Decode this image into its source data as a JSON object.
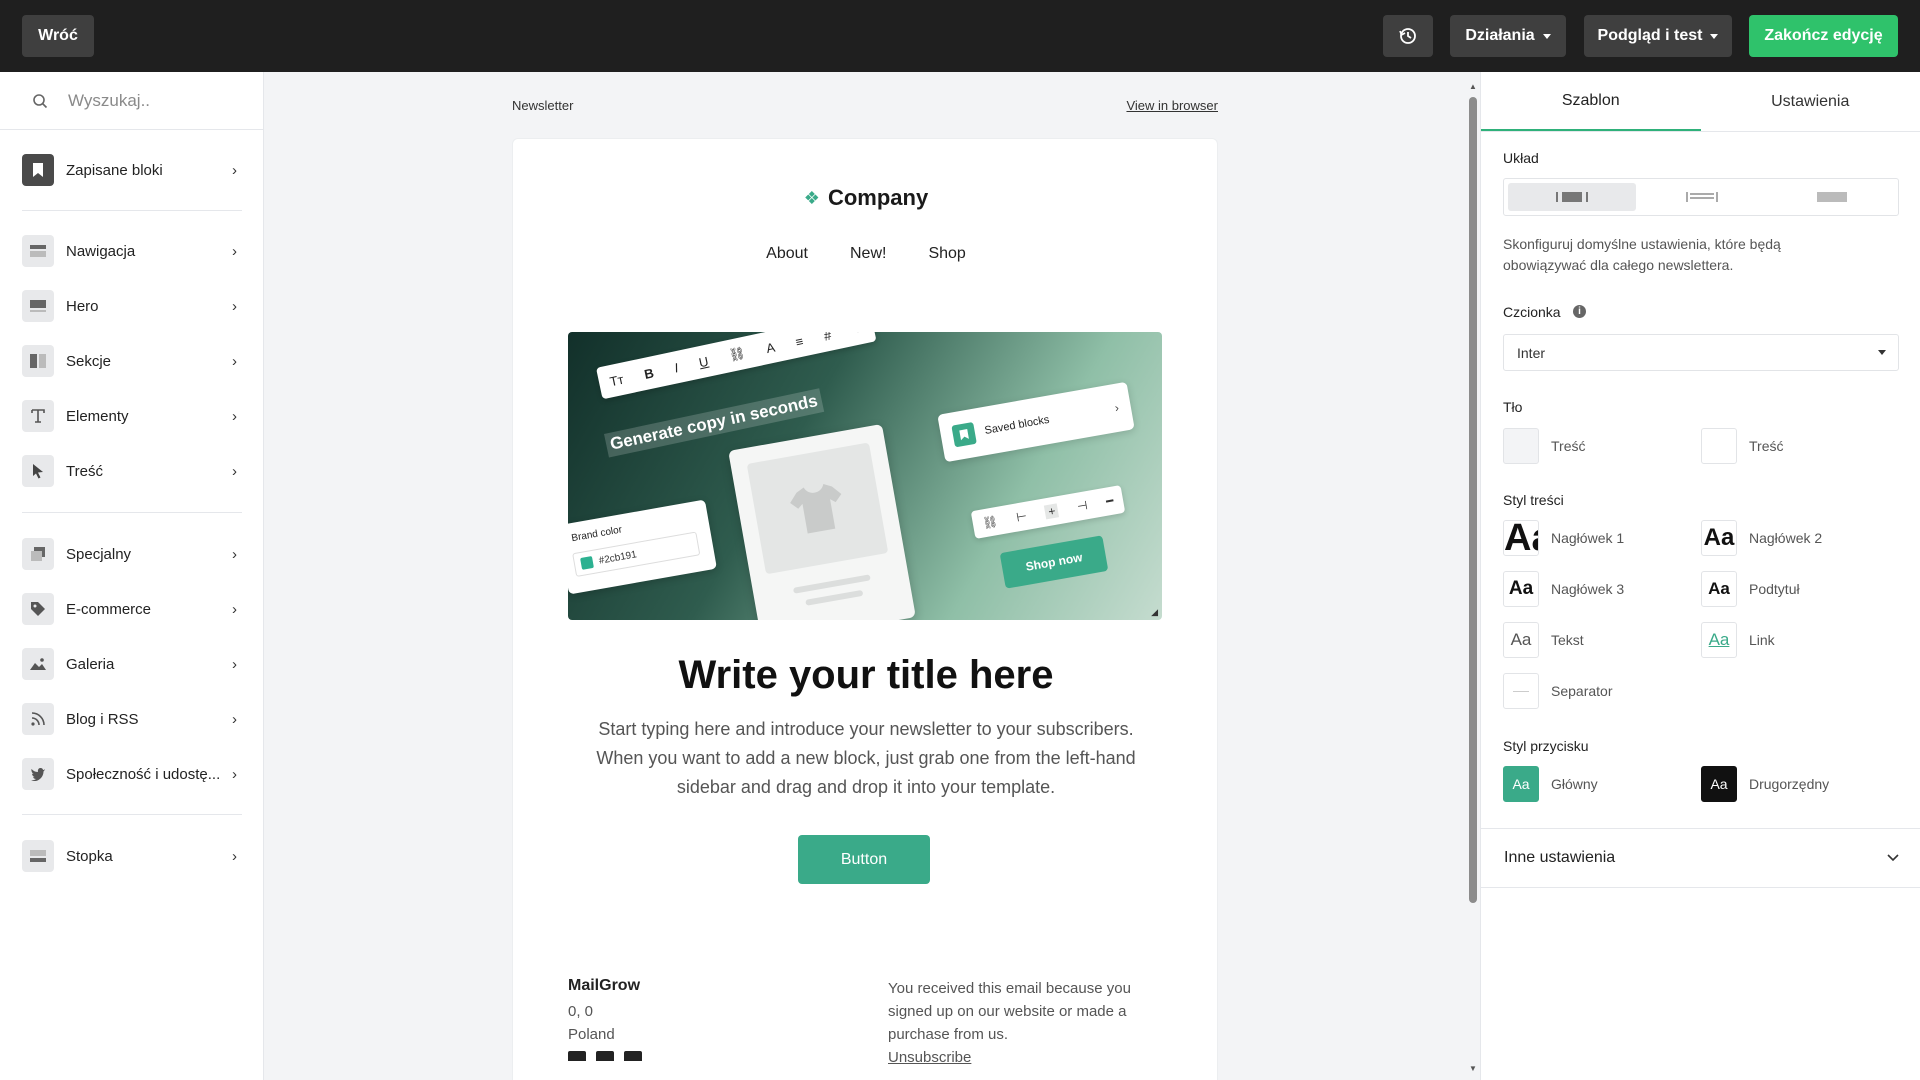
{
  "topbar": {
    "back": "Wróć",
    "actions": "Działania",
    "preview": "Podgląd i test",
    "finish": "Zakończ edycję"
  },
  "sidebar": {
    "search_placeholder": "Wyszukaj..",
    "items": [
      {
        "label": "Zapisane bloki",
        "icon": "bookmark-icon"
      },
      {
        "label": "Nawigacja",
        "icon": "navigation-icon"
      },
      {
        "label": "Hero",
        "icon": "hero-icon"
      },
      {
        "label": "Sekcje",
        "icon": "sections-icon"
      },
      {
        "label": "Elementy",
        "icon": "text-icon"
      },
      {
        "label": "Treść",
        "icon": "cursor-icon"
      },
      {
        "label": "Specjalny",
        "icon": "special-icon"
      },
      {
        "label": "E-commerce",
        "icon": "tag-icon"
      },
      {
        "label": "Galeria",
        "icon": "image-icon"
      },
      {
        "label": "Blog i RSS",
        "icon": "rss-icon"
      },
      {
        "label": "Społeczność i udostę...",
        "icon": "twitter-icon"
      },
      {
        "label": "Stopka",
        "icon": "footer-icon"
      }
    ]
  },
  "email": {
    "header_label": "Newsletter",
    "view_in_browser": "View in browser",
    "logo": "Company",
    "nav": [
      "About",
      "New!",
      "Shop"
    ],
    "hero": {
      "toolbar_items": [
        "Tт",
        "B",
        "I",
        "U",
        "⛓",
        "A",
        "≡",
        "#",
        "✦"
      ],
      "tagline": "Generate copy in seconds",
      "saved_blocks": "Saved blocks",
      "brand_color_label": "Brand color",
      "brand_color_value": "#2cb191",
      "shop_now": "Shop now"
    },
    "title": "Write your title here",
    "body": "Start typing here and introduce your newsletter to your subscribers. When you want to add a new block, just grab one from the left-hand sidebar and drag and drop it into your template.",
    "button": "Button",
    "footer": {
      "company": "MailGrow",
      "line1": "0, 0",
      "line2": "Poland",
      "notice": "You received this email because you signed up on our website or made a purchase from us.",
      "unsubscribe": "Unsubscribe"
    }
  },
  "rpanel": {
    "tabs": [
      "Szablon",
      "Ustawienia"
    ],
    "layout_label": "Układ",
    "description": "Skonfiguruj domyślne ustawienia, które będą obowiązywać dla całego newslettera.",
    "font_label": "Czcionka",
    "font_value": "Inter",
    "bg_label": "Tło",
    "bg_items": [
      "Treść",
      "Treść"
    ],
    "content_style_label": "Styl treści",
    "styles": [
      {
        "sample": "Aa",
        "label": "Nagłówek 1"
      },
      {
        "sample": "Aa",
        "label": "Nagłówek 2"
      },
      {
        "sample": "Aa",
        "label": "Nagłówek 3"
      },
      {
        "sample": "Aa",
        "label": "Podtytuł"
      },
      {
        "sample": "Aa",
        "label": "Tekst"
      },
      {
        "sample": "Aa",
        "label": "Link"
      },
      {
        "sample": "",
        "label": "Separator"
      }
    ],
    "button_style_label": "Styl przycisku",
    "button_styles": [
      {
        "sample": "Aa",
        "label": "Główny"
      },
      {
        "sample": "Aa",
        "label": "Drugorzędny"
      }
    ],
    "other_settings": "Inne ustawienia"
  },
  "colors": {
    "accent": "#2fc26b",
    "email_button": "#3aaa89",
    "topbar": "#1f1f1f"
  }
}
